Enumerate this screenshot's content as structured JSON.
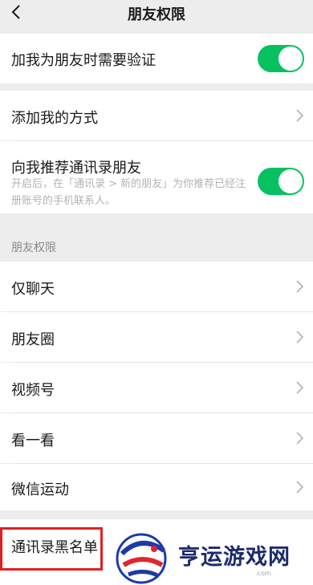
{
  "nav": {
    "title": "朋友权限"
  },
  "group1": {
    "verify": {
      "label": "加我为朋友时需要验证",
      "toggle_on": true
    }
  },
  "group2": {
    "add_method": {
      "label": "添加我的方式"
    },
    "recommend": {
      "label": "向我推荐通讯录朋友",
      "desc": "开启后，在「通讯录 > 新的朋友」为你推荐已经注册账号的手机联系人。",
      "toggle_on": true
    }
  },
  "permissions": {
    "section_title": "朋友权限",
    "items": [
      {
        "label": "仅聊天"
      },
      {
        "label": "朋友圈"
      },
      {
        "label": "视频号"
      },
      {
        "label": "看一看"
      },
      {
        "label": "微信运动"
      }
    ]
  },
  "blacklist": {
    "label": "通讯录黑名单"
  },
  "watermark": {
    "text": "亨运游戏网",
    "suffix": ".com"
  },
  "colors": {
    "accent": "#07c160",
    "highlight": "#e02020",
    "background": "#ededed"
  }
}
